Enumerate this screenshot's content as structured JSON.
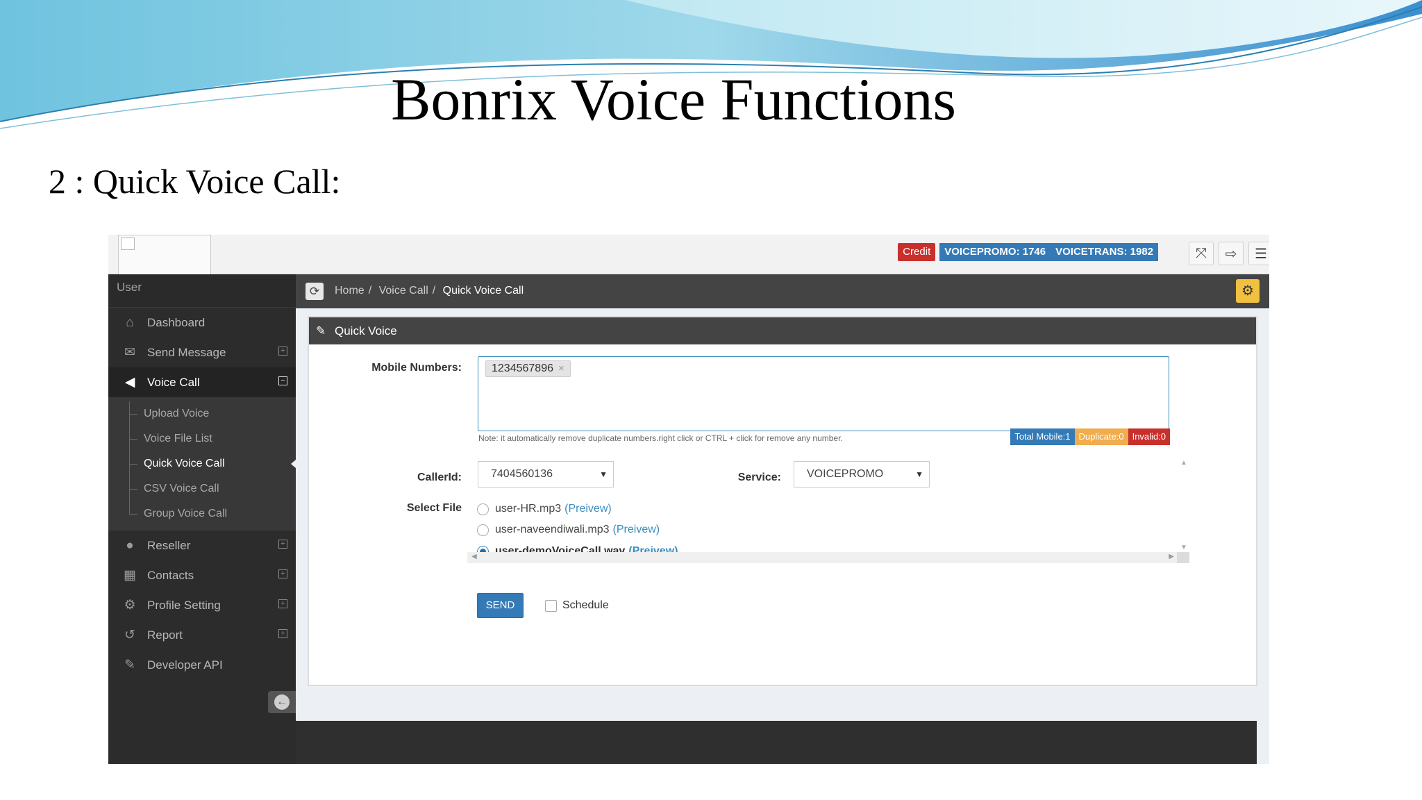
{
  "slide": {
    "title": "Bonrix Voice Functions",
    "subtitle": "2 : Quick Voice Call:"
  },
  "topbar": {
    "credit_label": "Credit",
    "voicepromo": "VOICEPROMO: 1746",
    "voicetrans": "VOICETRANS: 1982",
    "colors": {
      "credit": "#c9302c",
      "balance": "#337ab7"
    }
  },
  "sidebar": {
    "user_label": "User",
    "items": [
      {
        "label": "Dashboard",
        "icon": "home-icon",
        "expand": false
      },
      {
        "label": "Send Message",
        "icon": "envelope-icon",
        "expand": true
      },
      {
        "label": "Voice Call",
        "icon": "volume-icon",
        "expand": true,
        "expanded": true
      },
      {
        "label": "Reseller",
        "icon": "user-icon",
        "expand": true
      },
      {
        "label": "Contacts",
        "icon": "table-icon",
        "expand": true
      },
      {
        "label": "Profile Setting",
        "icon": "gear-icon",
        "expand": true
      },
      {
        "label": "Report",
        "icon": "history-icon",
        "expand": true
      },
      {
        "label": "Developer API",
        "icon": "wrench-icon",
        "expand": false
      }
    ],
    "voice_submenu": [
      "Upload Voice",
      "Voice File List",
      "Quick Voice Call",
      "CSV Voice Call",
      "Group Voice Call"
    ],
    "current_subitem": "Quick Voice Call"
  },
  "breadcrumb": {
    "home": "Home",
    "section": "Voice Call",
    "current": "Quick Voice Call"
  },
  "panel": {
    "title": "Quick Voice",
    "mobile_label": "Mobile Numbers:",
    "mobile_tag": "1234567896",
    "tag_remove": "×",
    "note": "Note: it automatically remove duplicate numbers.right click or CTRL + click for remove any number.",
    "total_mobile": "Total Mobile:1",
    "duplicate": "Duplicate:0",
    "invalid": "Invalid:0",
    "callerid_label": "CallerId:",
    "callerid_value": "7404560136",
    "service_label": "Service:",
    "service_value": "VOICEPROMO",
    "select_file_label": "Select File",
    "files": [
      {
        "name": "user-HR.mp3",
        "preview": "(Preivew)",
        "selected": false
      },
      {
        "name": "user-naveendiwali.mp3",
        "preview": "(Preivew)",
        "selected": false
      },
      {
        "name": "user-demoVoiceCall.wav",
        "preview": "(Preivew)",
        "selected": true
      }
    ],
    "send_label": "SEND",
    "schedule_label": "Schedule"
  }
}
